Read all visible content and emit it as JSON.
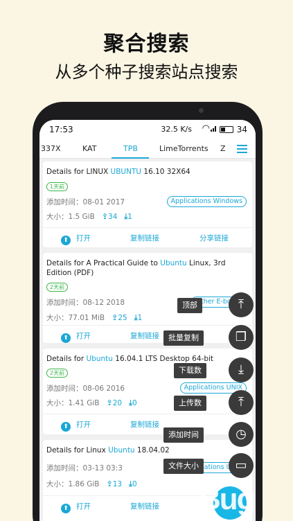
{
  "promo": {
    "title": "聚合搜索",
    "subtitle": "从多个种子搜索站点搜索"
  },
  "status_bar": {
    "time": "17:53",
    "speed": "32.5 K/s",
    "battery": "34"
  },
  "tabs": [
    "337X",
    "KAT",
    "TPB",
    "LimeTorrents",
    "Z"
  ],
  "active_tab": "TPB",
  "results": [
    {
      "title_prefix": "Details for LINUX ",
      "title_highlight": "UBUNTU",
      "title_suffix": " 16.10 32X64",
      "age": "1天前",
      "added": "添加时间：08-01 2017",
      "category": "Applications Windows",
      "size": "大小：1.5 GiB",
      "seeders": "34",
      "leechers": "1"
    },
    {
      "title_prefix": "Details for A Practical Guide to ",
      "title_highlight": "Ubuntu",
      "title_suffix": " Linux, 3rd Edition (PDF)",
      "age": "2天前",
      "added": "添加时间：08-12 2018",
      "category": "Other E-books",
      "size": "大小：77.01 MiB",
      "seeders": "25",
      "leechers": "1"
    },
    {
      "title_prefix": "Details for ",
      "title_highlight": "Ubuntu",
      "title_suffix": " 16.04.1 LTS Desktop 64-bit",
      "age": "2天前",
      "added": "添加时间：08-06 2016",
      "category": "Applications UNIX",
      "size": "大小：1.41 GiB",
      "seeders": "20",
      "leechers": "0"
    },
    {
      "title_prefix": "Details for Linux ",
      "title_highlight": "Ubuntu",
      "title_suffix": " 18.04.02",
      "age": "",
      "added": "添加时间：03-13 03:3",
      "category": "Applications UNIX",
      "size": "大小：1.86 GiB",
      "seeders": "13",
      "leechers": "0"
    }
  ],
  "actions": {
    "open": "打开",
    "copy_link": "复制链接",
    "share_link": "分享链接"
  },
  "fab_menu": [
    {
      "label": "顶部",
      "icon": "arrow-to-top-icon"
    },
    {
      "label": "批量复制",
      "icon": "copy-icon"
    },
    {
      "label": "下载数",
      "icon": "download-icon"
    },
    {
      "label": "上传数",
      "icon": "upload-icon"
    },
    {
      "label": "添加时间",
      "icon": "clock-icon"
    },
    {
      "label": "文件大小",
      "icon": "folder-icon"
    }
  ],
  "watermark": "Bug",
  "colors": {
    "accent": "#1ba7d6",
    "age_badge": "#3bb54a",
    "background": "#fbf6e4",
    "fab": "#19b7e6"
  }
}
